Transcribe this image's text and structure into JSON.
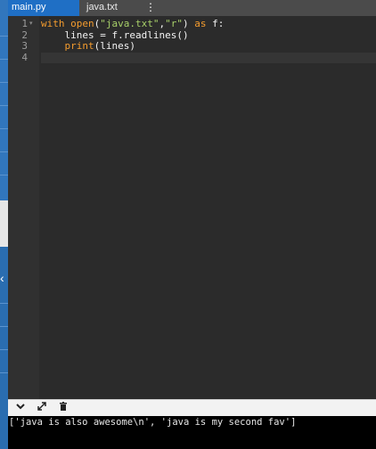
{
  "tabs": [
    {
      "label": "main.py",
      "active": true
    },
    {
      "label": "java.txt",
      "active": false
    }
  ],
  "tab_menu_icon": "vertical-dots-icon",
  "editor": {
    "line_numbers": [
      "1",
      "2",
      "3",
      "4"
    ],
    "lines": [
      [
        {
          "text": "with",
          "cls": "kw"
        },
        {
          "text": " ",
          "cls": "plain"
        },
        {
          "text": "open",
          "cls": "fn"
        },
        {
          "text": "(",
          "cls": "plain"
        },
        {
          "text": "\"java.txt\"",
          "cls": "str"
        },
        {
          "text": ",",
          "cls": "plain"
        },
        {
          "text": "\"r\"",
          "cls": "str"
        },
        {
          "text": ") ",
          "cls": "plain"
        },
        {
          "text": "as",
          "cls": "kw"
        },
        {
          "text": " f:",
          "cls": "plain"
        }
      ],
      [
        {
          "text": "    lines = f.readlines()",
          "cls": "plain"
        }
      ],
      [
        {
          "text": "    ",
          "cls": "plain"
        },
        {
          "text": "print",
          "cls": "fn"
        },
        {
          "text": "(lines)",
          "cls": "plain"
        }
      ],
      []
    ],
    "active_line": 4
  },
  "console": {
    "icons": [
      "chevron-down-icon",
      "expand-icon",
      "clear-icon"
    ],
    "output": "['java is also awesome\\n', 'java is my second fav']"
  },
  "colors": {
    "keyword": "#f49c2e",
    "string": "#a8d069",
    "tab_active": "#1f6fc5",
    "editor_bg": "#2b2b2b"
  }
}
